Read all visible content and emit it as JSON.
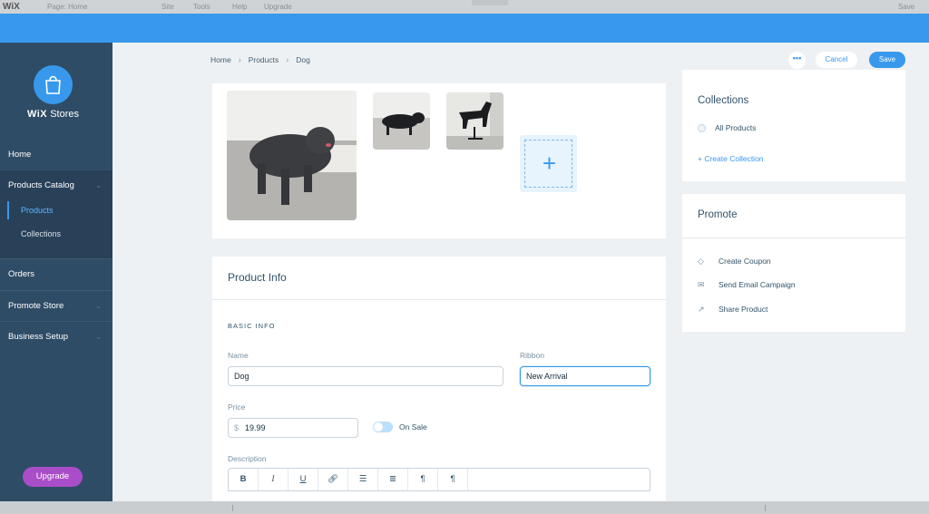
{
  "editor_bar": {
    "logo": "WiX",
    "items": [
      "Page: Home",
      "Site",
      "Tools",
      "Help",
      "Upgrade",
      "Save"
    ]
  },
  "sidebar": {
    "brand_bold": "WiX",
    "brand_rest": "Stores",
    "items": {
      "home": "Home",
      "products_catalog": "Products Catalog",
      "products": "Products",
      "collections": "Collections",
      "orders": "Orders",
      "promote_store": "Promote Store",
      "business_setup": "Business Setup"
    },
    "upgrade": "Upgrade"
  },
  "breadcrumb": [
    "Home",
    "Products",
    "Dog"
  ],
  "actions": {
    "more": "•••",
    "cancel": "Cancel",
    "save": "Save"
  },
  "product_info": {
    "title": "Product Info",
    "section": "BASIC INFO",
    "name_label": "Name",
    "name_value": "Dog",
    "ribbon_label": "Ribbon",
    "ribbon_value": "New Arrival",
    "price_label": "Price",
    "currency": "$",
    "price_value": "19.99",
    "on_sale_label": "On Sale",
    "on_sale": false,
    "description_label": "Description",
    "toolbar": [
      "B",
      "I",
      "U",
      "link",
      "bullets",
      "numbers",
      "indent-left",
      "indent-right"
    ]
  },
  "collections": {
    "title": "Collections",
    "item": "All Products",
    "create": "+ Create Collection"
  },
  "promote": {
    "title": "Promote",
    "items": [
      "Create Coupon",
      "Send Email Campaign",
      "Share Product"
    ]
  },
  "colors": {
    "accent": "#3899ec",
    "sidebar": "#2f4c66",
    "upgrade": "#aa4dc8"
  }
}
